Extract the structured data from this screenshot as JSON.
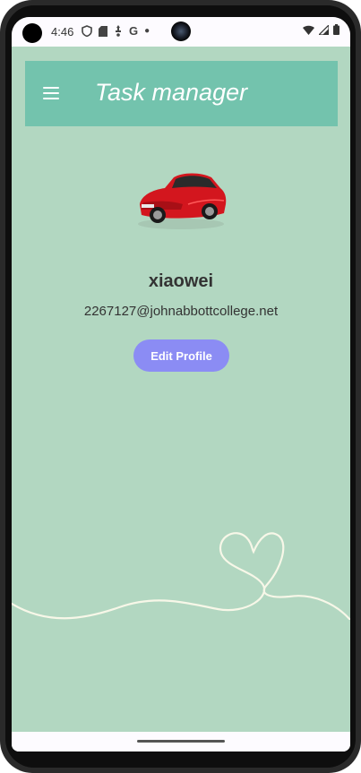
{
  "status_bar": {
    "time": "4:46",
    "left_icons": [
      "shield-icon",
      "sim-card-icon",
      "usb-icon",
      "google-icon",
      "dot-icon"
    ],
    "right_icons": [
      "wifi-icon",
      "signal-icon",
      "battery-icon"
    ]
  },
  "app_bar": {
    "title": "Task manager",
    "menu_icon": "hamburger-menu-icon",
    "background": "#73c3ad"
  },
  "profile": {
    "avatar_description": "red car image",
    "username": "xiaowei",
    "email": "2267127@johnabbottcollege.net",
    "edit_button_label": "Edit Profile",
    "edit_button_color": "#8b8cf4"
  },
  "theme": {
    "background": "#b2d7c1"
  }
}
